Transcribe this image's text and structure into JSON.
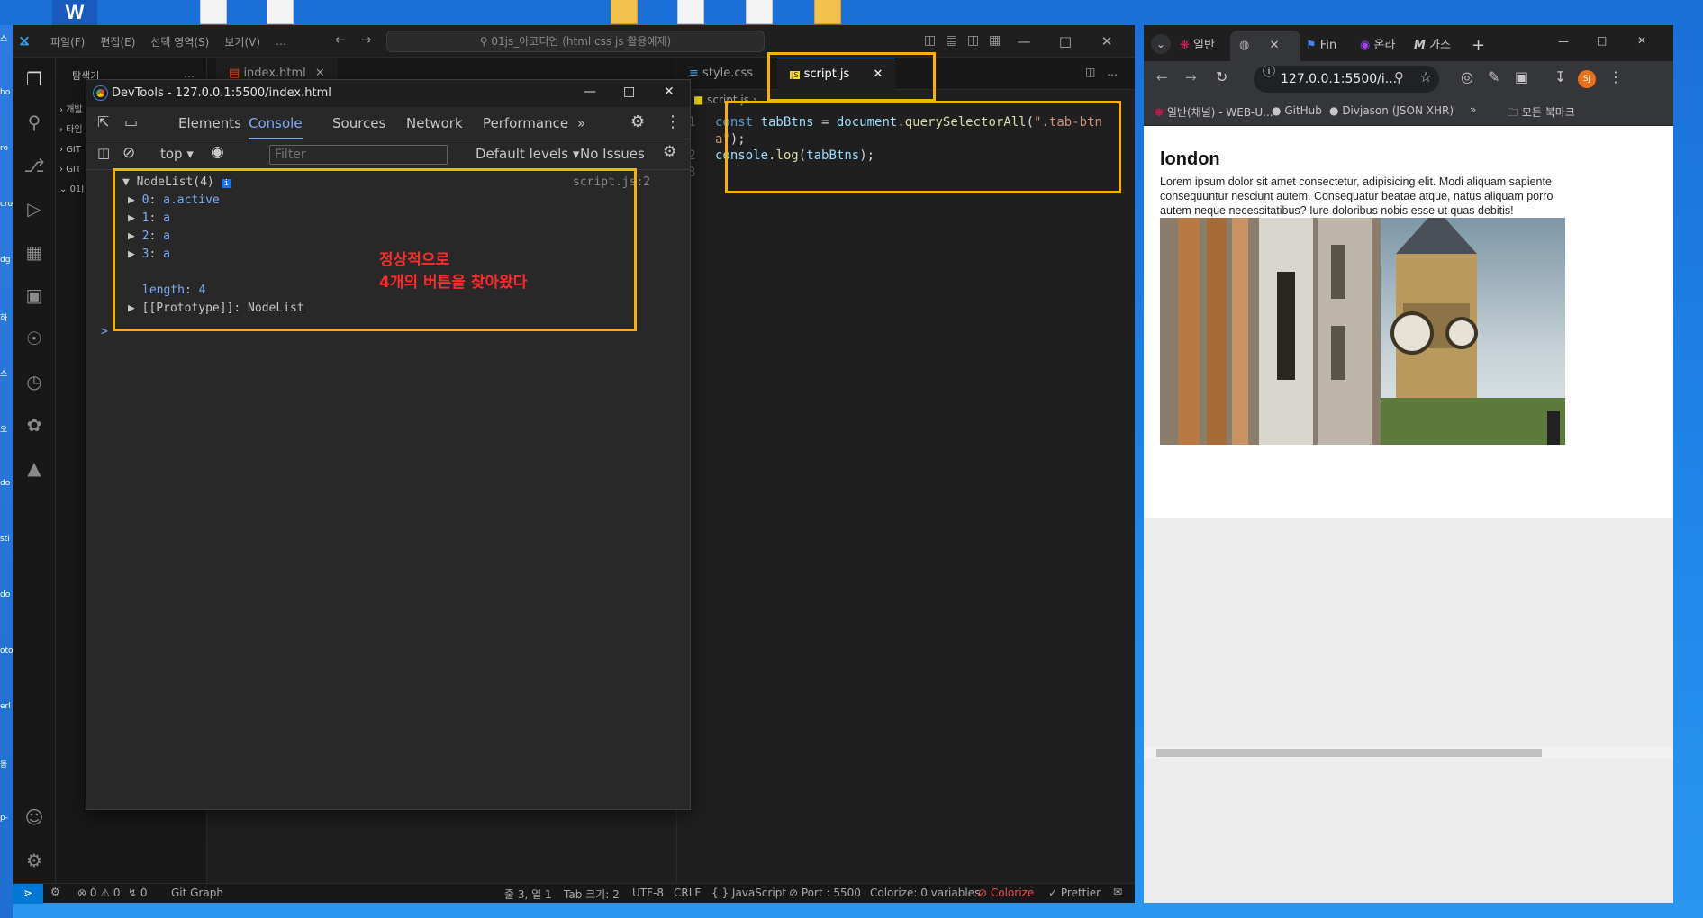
{
  "desktop": {
    "word_tile": "W",
    "left_strip_labels": [
      "스",
      "bo",
      "ro",
      "cro",
      "dg",
      "하",
      "스",
      "오",
      "do",
      "sti",
      "do",
      "oto",
      "erl",
      "동",
      "p-"
    ]
  },
  "vscode": {
    "menu": [
      "파일(F)",
      "편집(E)",
      "선택 영역(S)",
      "보기(V)",
      "…"
    ],
    "command_center": "01js_아코디언 (html css js 활용예제)",
    "explorer_title": "탐색기",
    "explorer_items": [
      "개발",
      "타임",
      "GIT",
      "GIT",
      "01J"
    ],
    "tabs": [
      "index.html",
      "style.css",
      "script.js"
    ],
    "breadcrumb": "script.js",
    "code_lines": [
      {
        "num": "1",
        "tokens": [
          [
            "kw",
            "const "
          ],
          [
            "vr",
            "tabBtns "
          ],
          [
            "",
            "= "
          ],
          [
            "vr",
            "document"
          ],
          [
            "",
            "."
          ],
          [
            "fn",
            "querySelectorAll"
          ],
          [
            "",
            "("
          ],
          [
            "st",
            "\".tab-btn"
          ]
        ]
      },
      {
        "num": "",
        "tokens": [
          [
            "st",
            "a\""
          ],
          [
            "",
            ");"
          ]
        ]
      },
      {
        "num": "2",
        "tokens": [
          [
            "vr",
            "console"
          ],
          [
            "",
            "."
          ],
          [
            "fn",
            "log"
          ],
          [
            "",
            "("
          ],
          [
            "vr",
            "tabBtns"
          ],
          [
            "",
            ");"
          ]
        ]
      },
      {
        "num": "3",
        "tokens": []
      }
    ],
    "status": {
      "errors": "⊗ 0 ⚠ 0",
      "ports": "\u0001 0",
      "git_graph": "Git Graph",
      "cursor": "줄 3, 열 1",
      "tab_size": "Tab 크기: 2",
      "encoding": "UTF-8",
      "eol": "CRLF",
      "language": "{ } JavaScript",
      "port": "⊘ Port : 5500",
      "colorize_vars": "Colorize: 0 variables",
      "colorize": "⊘ Colorize",
      "prettier": "✓ Prettier"
    }
  },
  "devtools": {
    "title": "DevTools - 127.0.0.1:5500/index.html",
    "tabs": [
      "Elements",
      "Console",
      "Sources",
      "Network",
      "Performance"
    ],
    "active_tab": "Console",
    "context": "top",
    "filter_placeholder": "Filter",
    "levels": "Default levels",
    "issues": "No Issues",
    "log_source": "script.js:2",
    "nodelist": "NodeList(4)",
    "entries": [
      {
        "key": "0",
        "val": "a.active"
      },
      {
        "key": "1",
        "val": "a"
      },
      {
        "key": "2",
        "val": "a"
      },
      {
        "key": "3",
        "val": "a"
      }
    ],
    "length_label": "length",
    "length_value": "4",
    "prototype": "[[Prototype]]: NodeList",
    "annotation_line1": "정상적으로",
    "annotation_line2": "4개의 버튼을 찾아왔다"
  },
  "chrome": {
    "tabs": [
      "일반",
      "",
      "Fin",
      "온라",
      "가스"
    ],
    "url": "127.0.0.1:5500/i...",
    "profile": "SJ",
    "bookmarks": [
      "일반(채널) - WEB-U...",
      "GitHub",
      "Divjason (JSON XHR)"
    ],
    "all_bookmarks": "모든 북마크",
    "page": {
      "heading": "london",
      "body": "Lorem ipsum dolor sit amet consectetur, adipisicing elit. Modi aliquam sapiente consequuntur nesciunt autem. Consequatur beatae atque, natus aliquam porro autem neque necessitatibus? Iure doloribus nobis esse ut quas debitis!"
    }
  },
  "colors": {
    "highlight": "#f4b400",
    "annotation": "#ff2a2a",
    "accent_blue": "#7cacf8",
    "vscode_remote": "#0078d4"
  }
}
